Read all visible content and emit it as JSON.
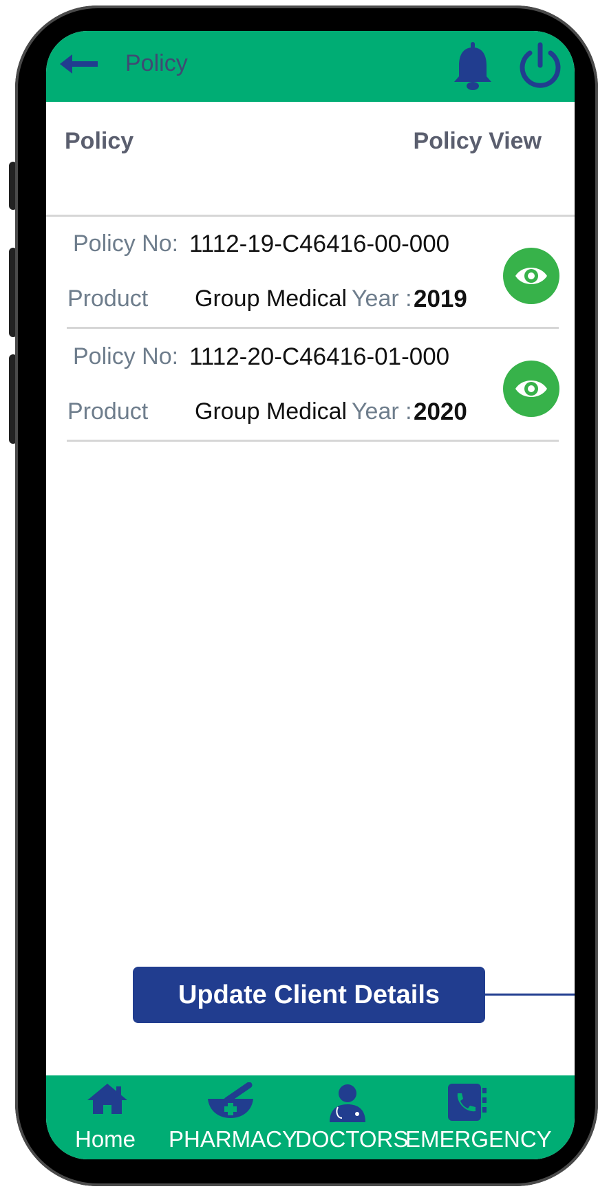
{
  "topbar": {
    "title": "Policy"
  },
  "header": {
    "left": "Policy",
    "right": "Policy View"
  },
  "policies": [
    {
      "policy_no_label": "Policy No:",
      "policy_no": "1112-19-C46416-00-000",
      "product_label": "Product",
      "product": "Group Medical",
      "year_label": "Year :",
      "year": "2019"
    },
    {
      "policy_no_label": "Policy No:",
      "policy_no": "1112-20-C46416-01-000",
      "product_label": "Product",
      "product": "Group Medical",
      "year_label": "Year :",
      "year": "2020"
    }
  ],
  "update_button": "Update Client Details",
  "bottom_nav": [
    {
      "label": "Home",
      "icon": "home-icon"
    },
    {
      "label": "PHARMACY",
      "icon": "mortar-pestle-icon"
    },
    {
      "label": "DOCTORS",
      "icon": "doctor-icon"
    },
    {
      "label": "EMERGENCY",
      "icon": "phone-book-icon"
    }
  ],
  "colors": {
    "primary_green": "#00ad74",
    "navy": "#213d8f",
    "eye_green": "#37b24a"
  }
}
